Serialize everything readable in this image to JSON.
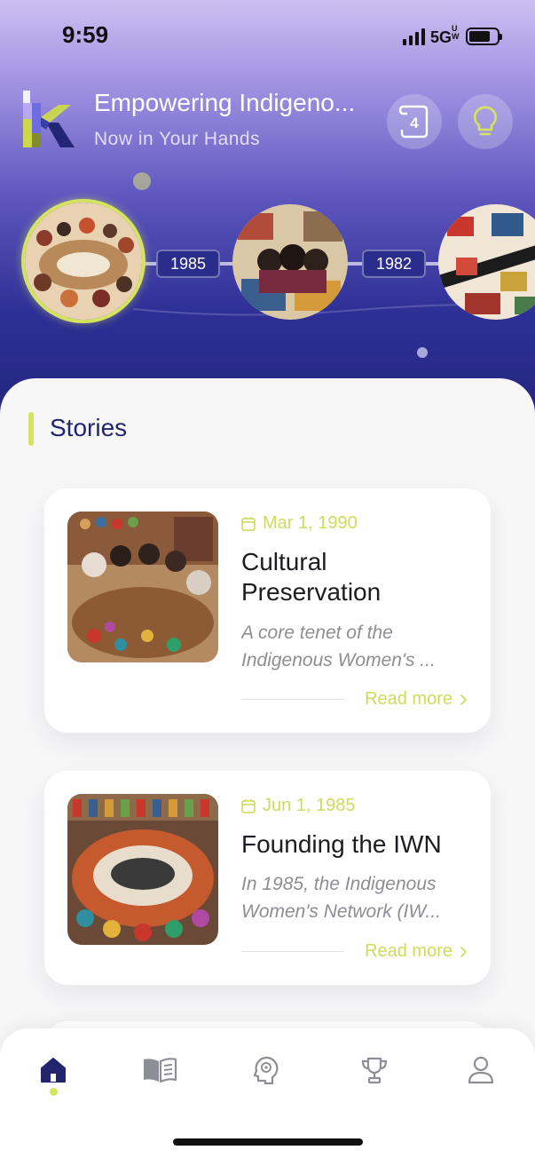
{
  "status_bar": {
    "time": "9:59",
    "network": "5G",
    "network_sup": "UW",
    "battery_level": 0.75
  },
  "header": {
    "title": "Empowering Indigeno...",
    "subtitle": "Now in Your Hands",
    "badge_count": "4",
    "icons": [
      "logo-k",
      "scroll-badge-icon",
      "lightbulb-icon"
    ]
  },
  "timeline": {
    "years": [
      "1985",
      "1982"
    ],
    "items": [
      {
        "name": "timeline-item-1",
        "selected": true
      },
      {
        "name": "timeline-item-2",
        "selected": false
      },
      {
        "name": "timeline-item-3",
        "selected": false
      }
    ]
  },
  "stories": {
    "section_title": "Stories",
    "items": [
      {
        "date": "Mar 1, 1990",
        "title_line1": "Cultural",
        "title_line2": "Preservation",
        "excerpt_line1": "A core tenet of the",
        "excerpt_line2": "Indigenous Women's ...",
        "read_more": "Read more"
      },
      {
        "date": "Jun 1, 1985",
        "title_line1": "Founding the IWN",
        "title_line2": "",
        "excerpt_line1": "In 1985, the Indigenous",
        "excerpt_line2": "Women's Network (IW...",
        "read_more": "Read more"
      }
    ]
  },
  "bottom_nav": {
    "items": [
      "home-icon",
      "book-icon",
      "brain-icon",
      "trophy-icon",
      "profile-icon"
    ],
    "active_index": 0
  },
  "colors": {
    "accent": "#d5e45e",
    "primary": "#22246e",
    "date": "#cddc5a"
  }
}
